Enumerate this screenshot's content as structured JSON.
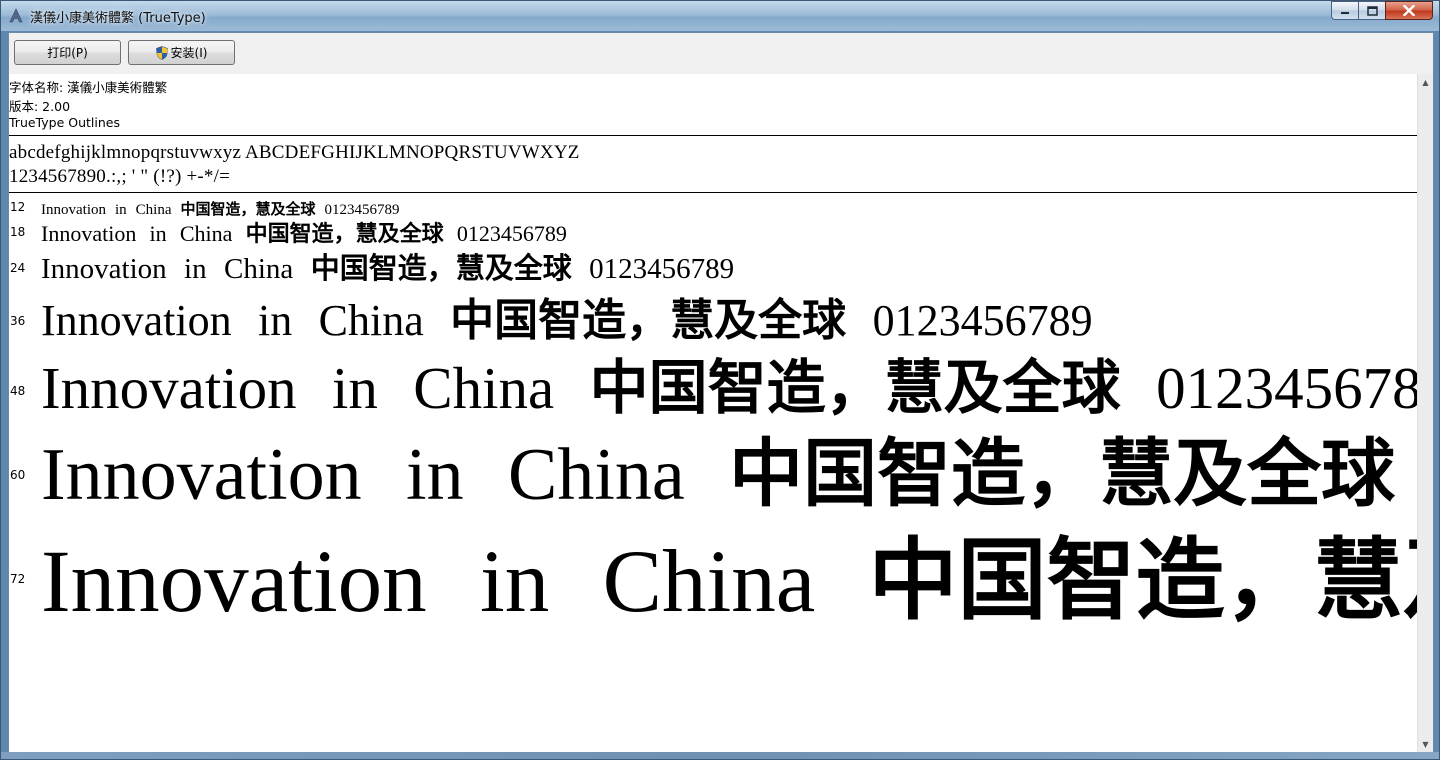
{
  "window": {
    "title": "漢儀小康美術體繁 (TrueType)"
  },
  "toolbar": {
    "print_label": "打印(P)",
    "install_label": "安装(I)"
  },
  "font_info": {
    "name_line": "字体名称: 漢儀小康美術體繁",
    "version_line": "版本: 2.00",
    "outline_line": "TrueType Outlines"
  },
  "charset": {
    "letters": "abcdefghijklmnopqrstuvwxyz ABCDEFGHIJKLMNOPQRSTUVWXYZ",
    "digits_symbols": "1234567890.:,; ' \" (!?) +-*/="
  },
  "samples": {
    "latin": "Innovation in China",
    "cjk": "中国智造，慧及全球",
    "digits": "0123456789",
    "sizes": [
      {
        "label": "12"
      },
      {
        "label": "18"
      },
      {
        "label": "24"
      },
      {
        "label": "36"
      },
      {
        "label": "48"
      },
      {
        "label": "60"
      },
      {
        "label": "72"
      }
    ]
  },
  "icons": {
    "app": "font-file-icon",
    "install": "uac-shield-icon",
    "minimize": "minimize-icon",
    "maximize": "maximize-icon",
    "close": "close-icon"
  },
  "colors": {
    "titlebar": "#9dbcd8",
    "close_button": "#c0391c",
    "toolbar_bg": "#f0f0f0",
    "content_bg": "#ffffff"
  }
}
